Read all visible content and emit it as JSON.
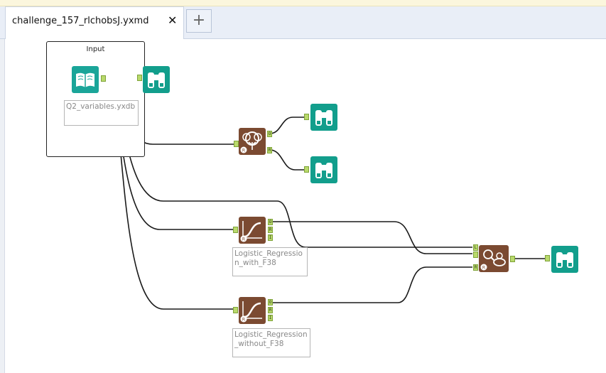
{
  "tab": {
    "title": "challenge_157_rlchobsJ.yxmd",
    "close": "✕",
    "add": "+"
  },
  "container": {
    "title": "Input"
  },
  "tools": {
    "input": {
      "label": "Q2_variables.yxdb"
    },
    "logistic_with": {
      "label": "Logistic_Regression_with_F38"
    },
    "logistic_without": {
      "label": "Logistic_Regression_without_F38"
    }
  },
  "anchors": {
    "O": "O",
    "R": "R",
    "I": "I",
    "L": "L"
  },
  "colors": {
    "browse": "#129e8c",
    "predictive": "#7b4a31",
    "anchor": "#b9d96b",
    "input": "#1aa599"
  }
}
